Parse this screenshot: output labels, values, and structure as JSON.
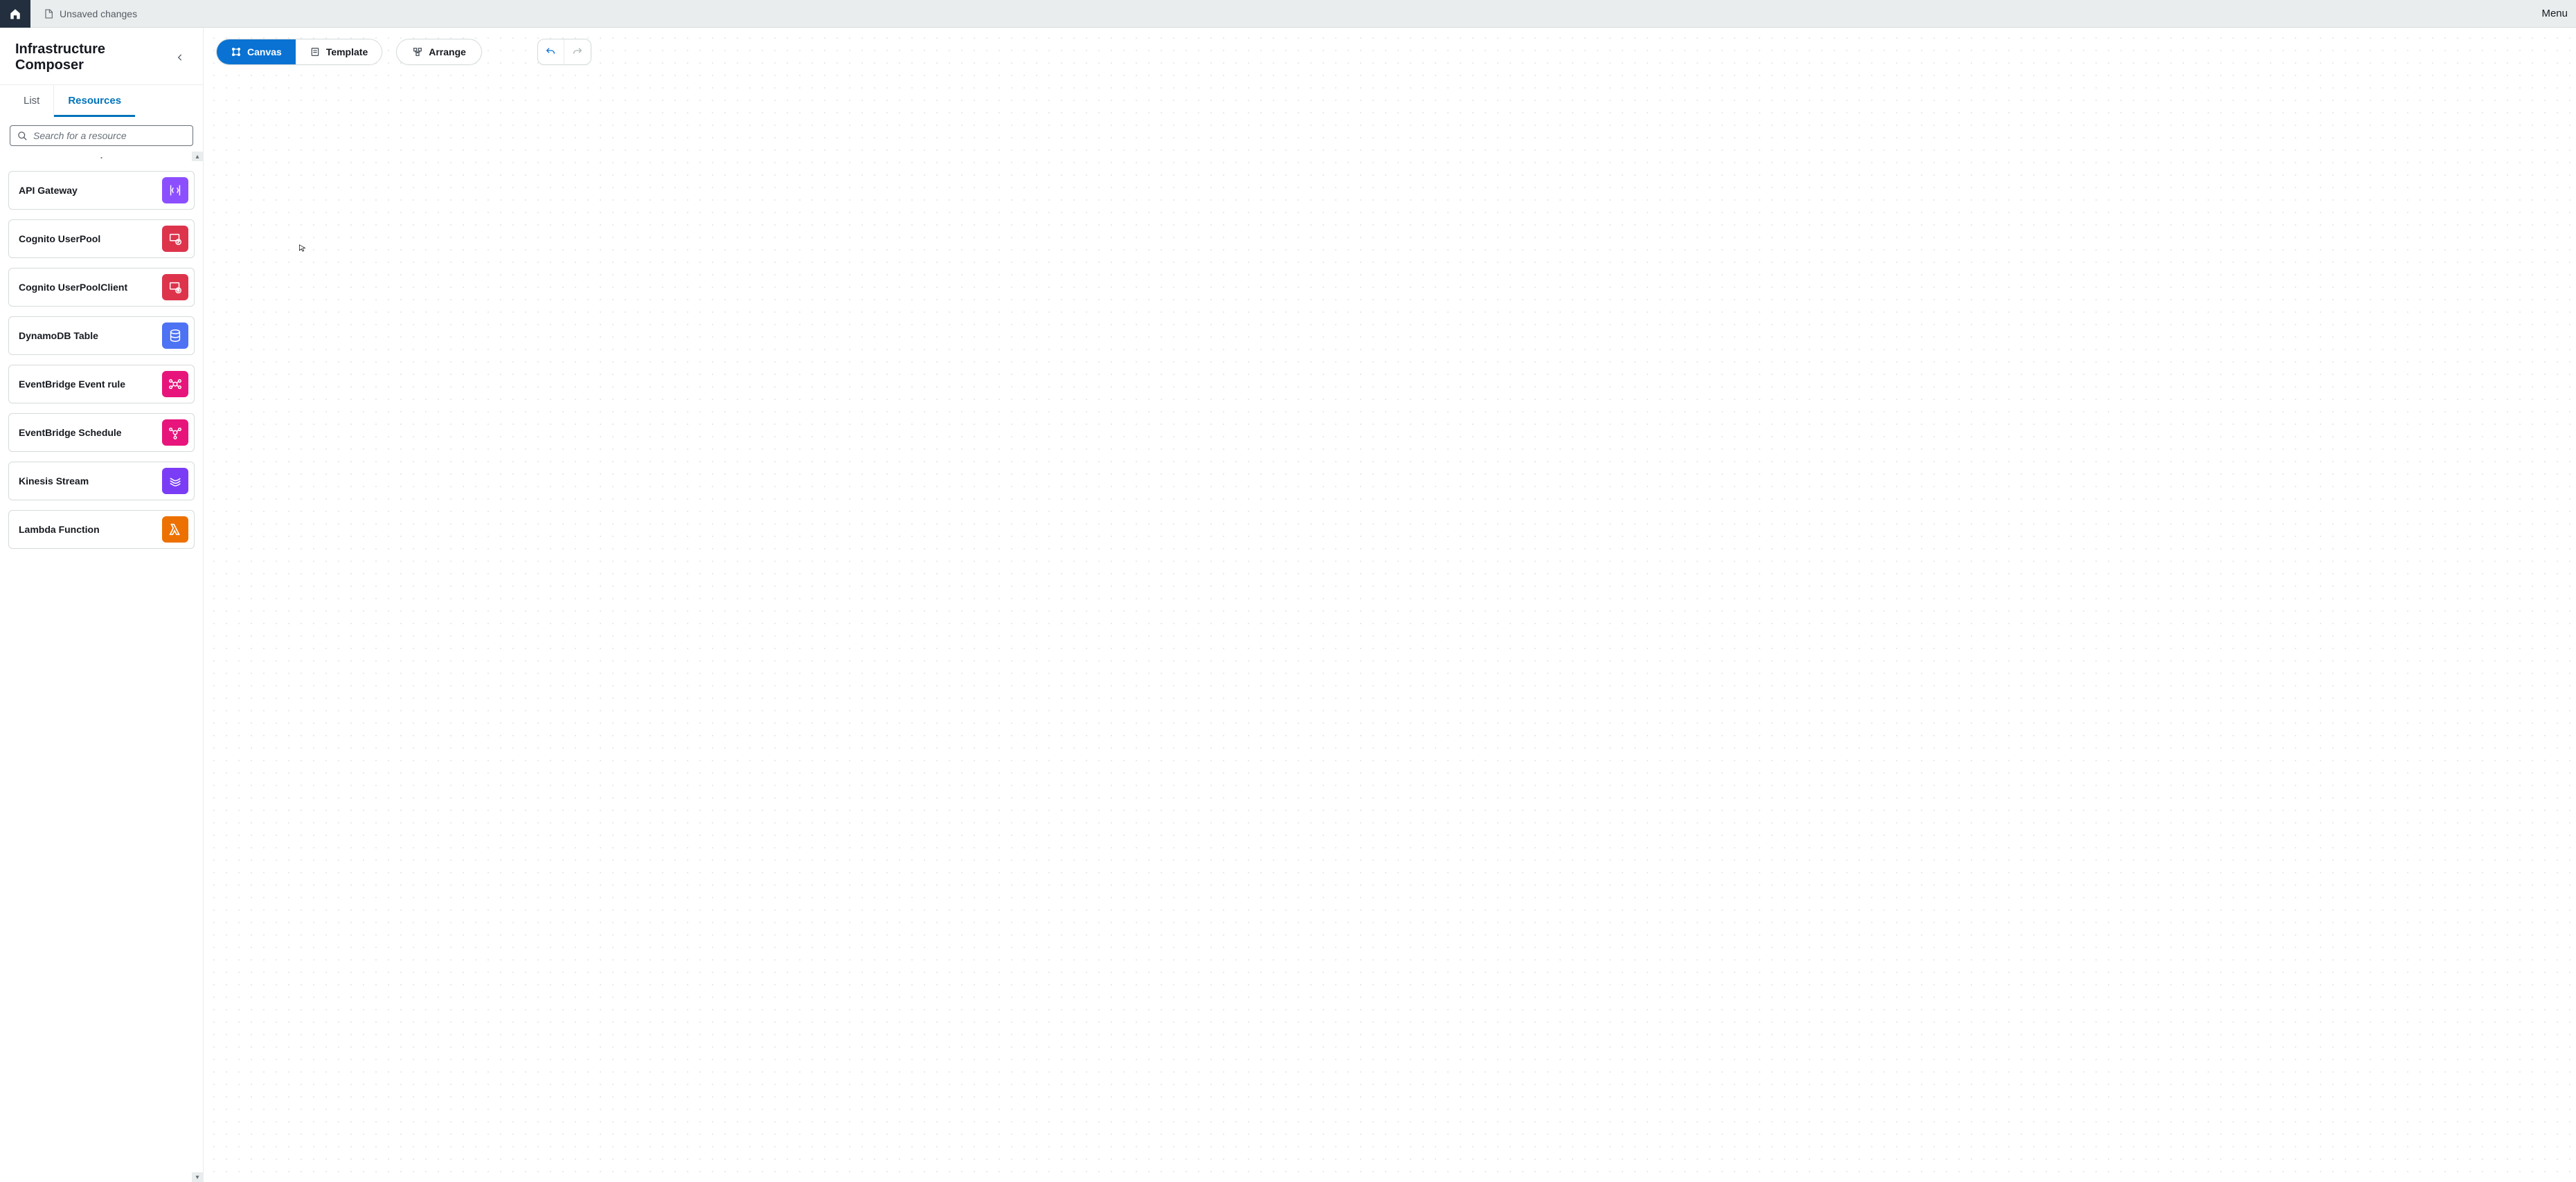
{
  "topbar": {
    "status_text": "Unsaved changes",
    "menu_label": "Menu"
  },
  "sidebar": {
    "title": "Infrastructure Composer",
    "tabs": [
      {
        "label": "List",
        "active": false
      },
      {
        "label": "Resources",
        "active": true
      }
    ],
    "search_placeholder": "Search for a resource",
    "resources": [
      {
        "label": "API Gateway",
        "icon": "api-gateway-icon",
        "color": "bg-purple"
      },
      {
        "label": "Cognito UserPool",
        "icon": "cognito-icon",
        "color": "bg-red"
      },
      {
        "label": "Cognito UserPoolClient",
        "icon": "cognito-client-icon",
        "color": "bg-red"
      },
      {
        "label": "DynamoDB Table",
        "icon": "dynamodb-icon",
        "color": "bg-blue"
      },
      {
        "label": "EventBridge Event rule",
        "icon": "eventbridge-icon",
        "color": "bg-pink"
      },
      {
        "label": "EventBridge Schedule",
        "icon": "eventbridge-sched-icon",
        "color": "bg-pink"
      },
      {
        "label": "Kinesis Stream",
        "icon": "kinesis-icon",
        "color": "bg-violet"
      },
      {
        "label": "Lambda Function",
        "icon": "lambda-icon",
        "color": "bg-orange"
      }
    ]
  },
  "toolbar": {
    "canvas_label": "Canvas",
    "template_label": "Template",
    "arrange_label": "Arrange"
  }
}
